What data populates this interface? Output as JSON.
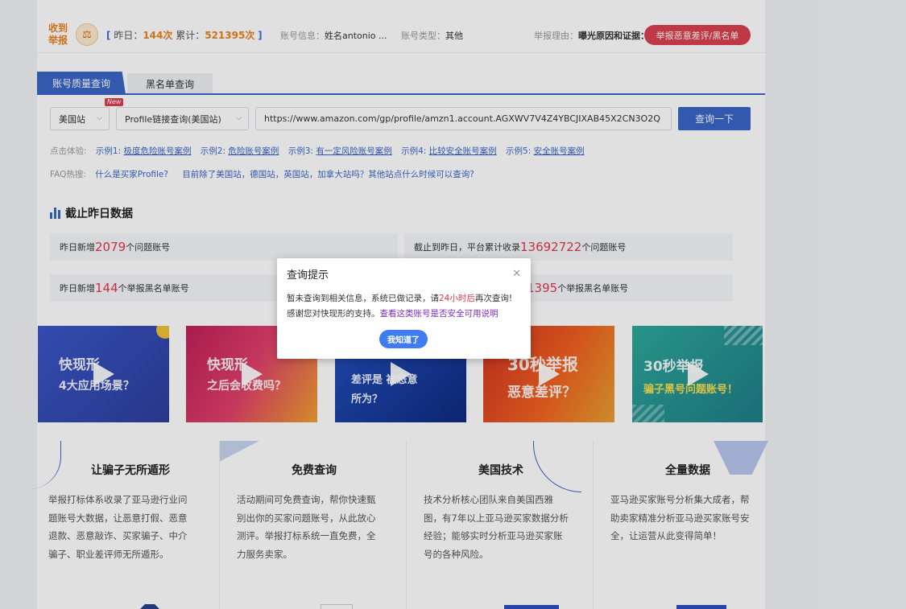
{
  "topbar": {
    "badge_line1": "收到",
    "badge_line2": "举报",
    "avatar_icon": "hammer-icon",
    "bracket_left": "[",
    "yesterday_label": "昨日：",
    "yesterday_count": "144次",
    "total_label": "累计：",
    "total_count": "521395次",
    "bracket_right": "]",
    "account_info_label": "账号信息：",
    "account_info_value": "姓名antonio ...",
    "account_type_label": "账号类型：",
    "account_type_value": "其他",
    "report_reason_label": "举报理由：",
    "report_reason_value": "曝光原因和证据：",
    "report_button": "举报恶意差评/黑名单"
  },
  "tabs": {
    "active": "账号质量查询",
    "inactive": "黑名单查询"
  },
  "search": {
    "site": "美国站",
    "new_badge": "New",
    "mode": "Profile链接查询(美国站)",
    "url_value": "https://www.amazon.com/gp/profile/amzn1.account.AGXWV7V4Z4YBCJIXAB45X2CN3O2Q",
    "query_button": "查询一下"
  },
  "examples": {
    "label": "点击体验:",
    "items": [
      {
        "prefix": "示例1: ",
        "text": "极度危险账号案例"
      },
      {
        "prefix": "示例2: ",
        "text": "危险账号案例"
      },
      {
        "prefix": "示例3: ",
        "text": "有一定风险账号案例"
      },
      {
        "prefix": "示例4: ",
        "text": "比较安全账号案例"
      },
      {
        "prefix": "示例5: ",
        "text": "安全账号案例"
      }
    ]
  },
  "faq": {
    "label": "FAQ热搜:",
    "q1": "什么是买家Profile?",
    "q2": "目前除了美国站，德国站，英国站，加拿大站吗？其他站点什么时候可以查询?"
  },
  "stats_section": {
    "title": "截止昨日数据",
    "box1_prefix": "昨日新增",
    "box1_value": "2079",
    "box1_suffix": "个问题账号",
    "box2_prefix": "截止到昨日，平台累计收录",
    "box2_value": "13692722",
    "box2_suffix": "个问题账号",
    "box3_prefix": "昨日新增",
    "box3_value": "144",
    "box3_suffix": "个举报黑名单账号",
    "box4_value": "1395",
    "box4_suffix": "个举报黑名单账号"
  },
  "videos": [
    {
      "line1": "快现形",
      "line2": "4大应用场景？"
    },
    {
      "line1": "快现形",
      "line2": "之后会收费吗？"
    },
    {
      "line1": "差评是   被恶意",
      "line2": "所为？"
    },
    {
      "line1": "30秒举报",
      "line2": "恶意差评？"
    },
    {
      "line1": "30秒举报",
      "line2": "骗子黑号问题账号！"
    }
  ],
  "features": [
    {
      "title": "让骗子无所遁形",
      "desc": "举报打标体系收录了亚马逊行业问题账号大数据，让恶意打假、恶意退款、恶意敲诈、买家骗子、中介骗子、职业差评师无所遁形。"
    },
    {
      "title": "免费查询",
      "desc": "活动期间可免费查询，帮你快速甄别出你的买家问题账号，从此放心测评。举报打标系统一直免费，全力服务卖家。"
    },
    {
      "title": "美国技术",
      "desc": "技术分析核心团队来自美国西雅图，有7年以上亚马逊买家数据分析经验；能够实时分析亚马逊买家账号的各种风险。"
    },
    {
      "title": "全量数据",
      "desc": "亚马逊买家账号分析集大成者，帮助卖家精准分析亚马逊买家账号安全，让运营从此变得简单！"
    }
  ],
  "modal": {
    "title": "查询提示",
    "close_icon": "close-icon",
    "line1_a": "暂未查询到相关信息，系统已做记录，请",
    "line1_red": "24小时后",
    "line1_b": "再次查询!",
    "line2_a": "感谢您对快现形的支持。",
    "line2_link": "查看这类账号是否安全可用说明",
    "ok_button": "我知道了"
  }
}
